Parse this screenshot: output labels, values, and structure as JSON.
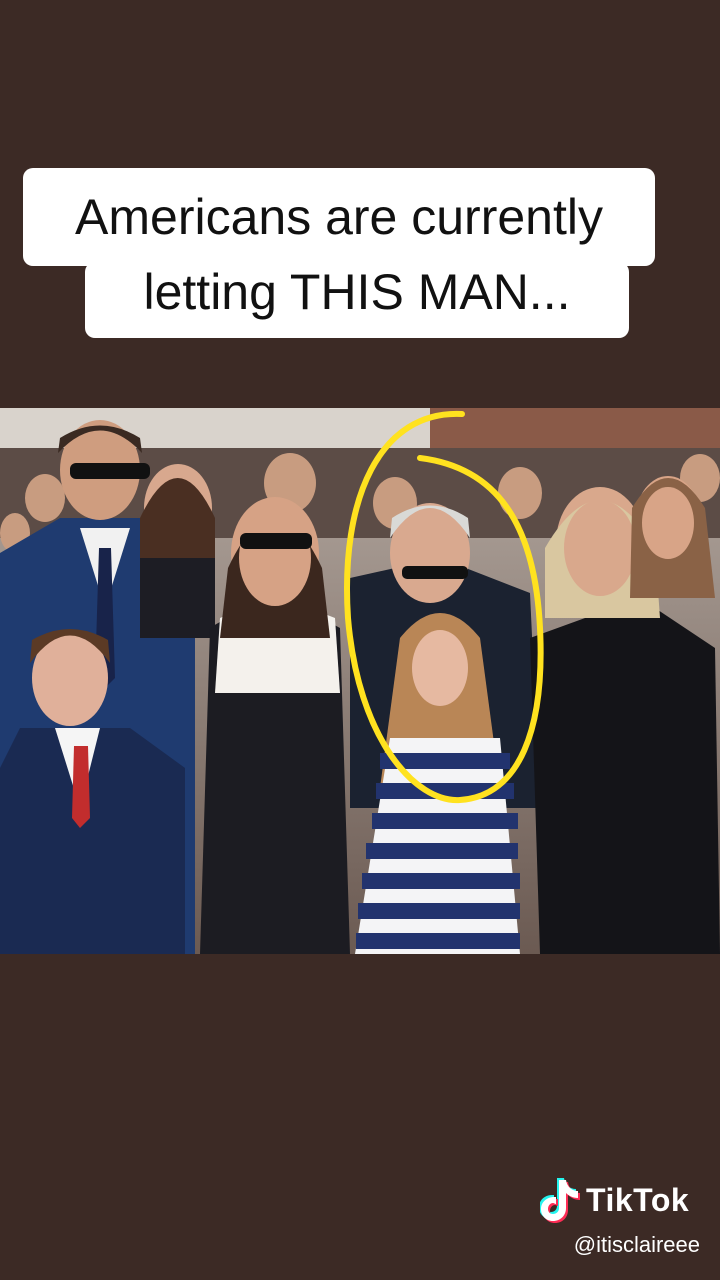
{
  "caption": {
    "line1": "Americans are currently",
    "line2": "letting THIS MAN..."
  },
  "photo": {
    "highlight_color": "#ffe21f"
  },
  "branding": {
    "app_name": "TikTok",
    "handle": "@itisclaireee",
    "icon": "tiktok-note-icon"
  },
  "colors": {
    "background": "#3c2a25",
    "caption_bg": "#ffffff",
    "caption_text": "#111111"
  }
}
